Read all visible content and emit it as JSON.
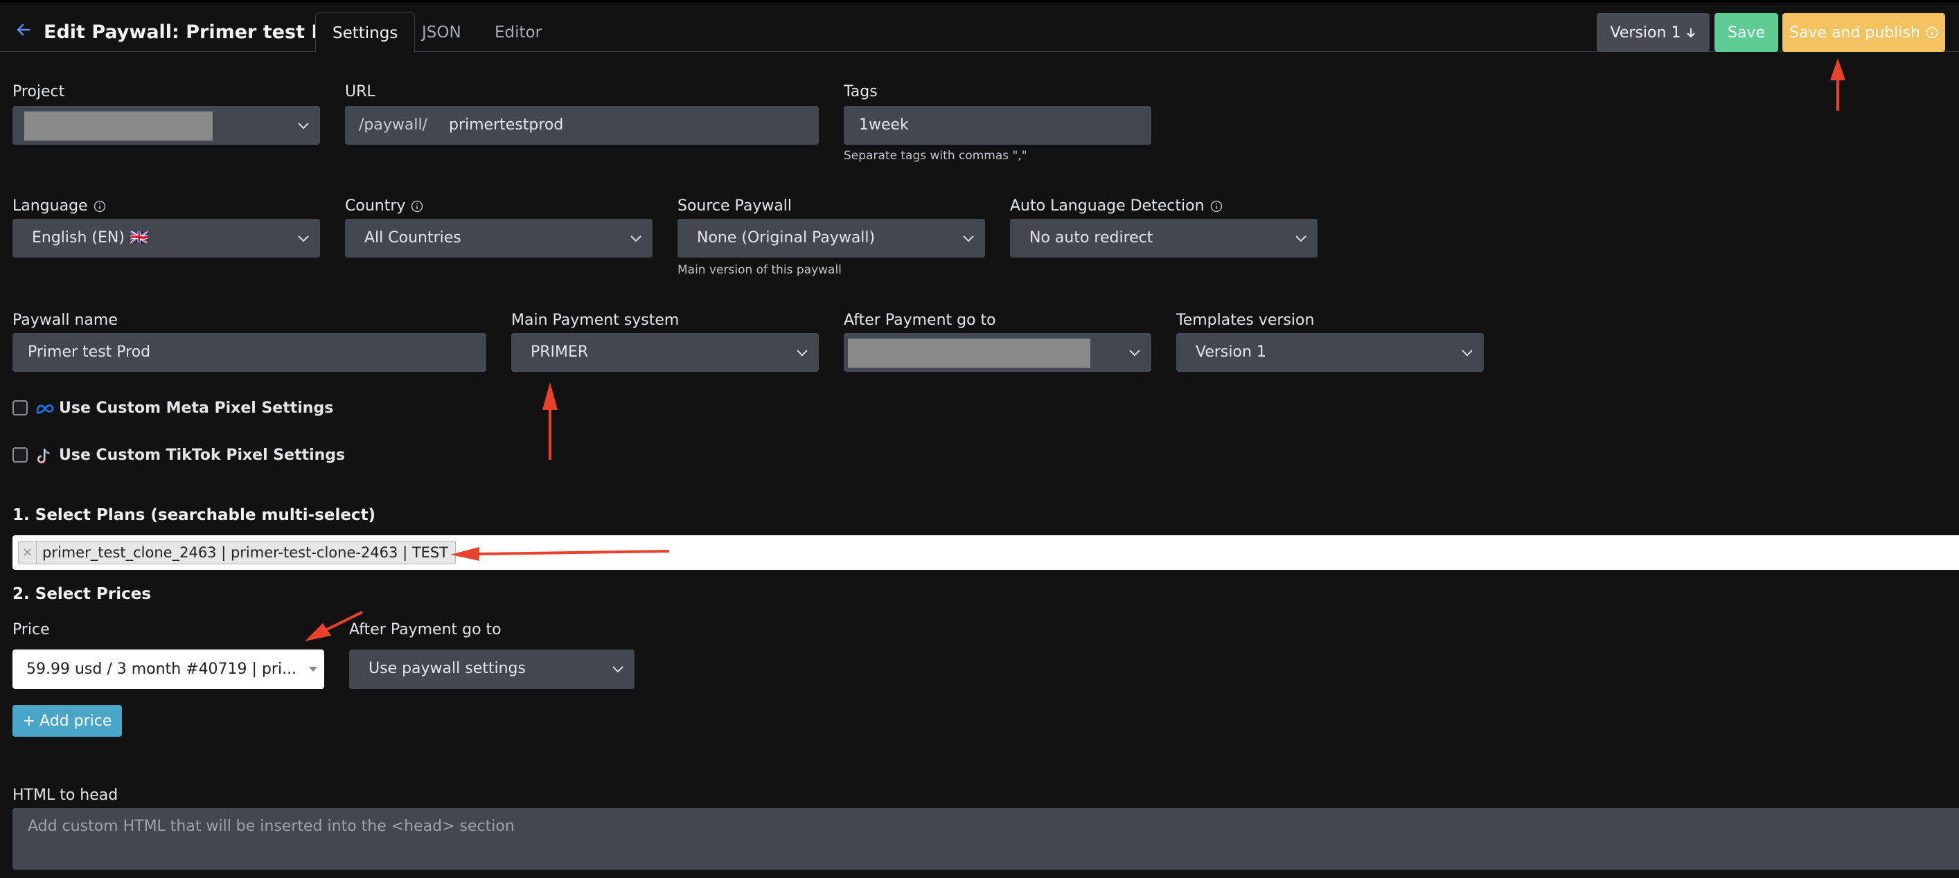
{
  "header": {
    "title": "Edit Paywall: Primer test Prod",
    "tabs": [
      {
        "label": "Settings",
        "active": true
      },
      {
        "label": "JSON",
        "active": false
      },
      {
        "label": "Editor",
        "active": false
      }
    ],
    "version_button": "Version 1",
    "save_button": "Save",
    "publish_button": "Save and publish"
  },
  "form": {
    "project": {
      "label": "Project",
      "value": ""
    },
    "url": {
      "label": "URL",
      "prefix": "/paywall/",
      "value": "primertestprod"
    },
    "tags": {
      "label": "Tags",
      "value": "1week",
      "help": "Separate tags with commas \",\""
    },
    "language": {
      "label": "Language",
      "value": "English (EN) 🇬🇧"
    },
    "country": {
      "label": "Country",
      "value": "All Countries"
    },
    "source_paywall": {
      "label": "Source Paywall",
      "value": "None (Original Paywall)",
      "help": "Main version of this paywall"
    },
    "auto_language": {
      "label": "Auto Language Detection",
      "value": "No auto redirect"
    },
    "paywall_name": {
      "label": "Paywall name",
      "value": "Primer test Prod"
    },
    "payment_system": {
      "label": "Main Payment system",
      "value": "PRIMER"
    },
    "after_payment": {
      "label": "After Payment go to",
      "value": ""
    },
    "templates_version": {
      "label": "Templates version",
      "value": "Version 1"
    },
    "meta_pixel": {
      "label": "Use Custom Meta Pixel Settings",
      "checked": false
    },
    "tiktok_pixel": {
      "label": "Use Custom TikTok Pixel Settings",
      "checked": false
    }
  },
  "plans": {
    "title": "1. Select Plans (searchable multi-select)",
    "selected": [
      "primer_test_clone_2463 | primer-test-clone-2463 | TEST"
    ]
  },
  "prices": {
    "title": "2. Select Prices",
    "price_label": "Price",
    "price_value": "59.99 usd / 3 month #40719 | pri...",
    "after_payment_label": "After Payment go to",
    "after_payment_value": "Use paywall settings",
    "add_price_button": "Add price"
  },
  "html_head": {
    "label": "HTML to head",
    "placeholder": "Add custom HTML that will be inserted into the <head> section"
  },
  "colors": {
    "background": "#121212",
    "field": "#434850",
    "save": "#5ecb95",
    "publish": "#f5c260",
    "add_price": "#4aa6c9",
    "annotation_arrow": "#e8412c"
  }
}
